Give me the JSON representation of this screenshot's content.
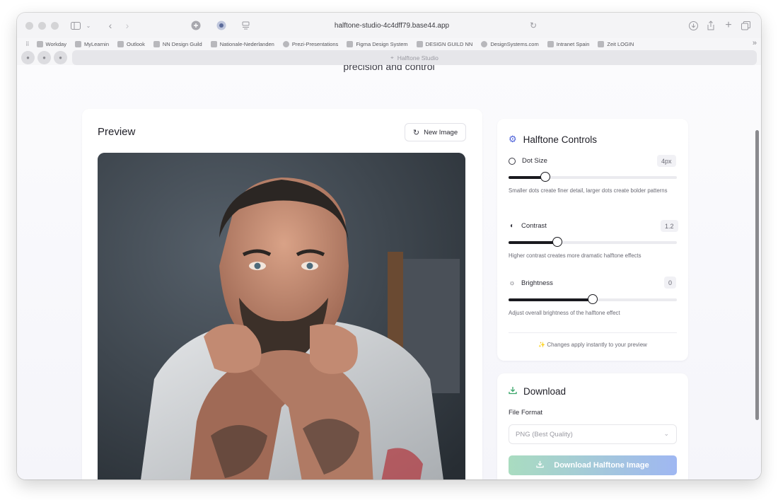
{
  "browser": {
    "url": "halftone-studio-4c4dff79.base44.app",
    "tab_title": "Halftone Studio",
    "bookmarks": [
      {
        "label": "Workday"
      },
      {
        "label": "MyLearnin"
      },
      {
        "label": "Outlook"
      },
      {
        "label": "NN Design Guild"
      },
      {
        "label": "Nationale-Nederlanden"
      },
      {
        "label": "Prezi-Presentations"
      },
      {
        "label": "Figma Design System"
      },
      {
        "label": "DESIGN GUILD NN"
      },
      {
        "label": "DesignSystems.com"
      },
      {
        "label": "Intranet Spain"
      },
      {
        "label": "Zeit LOGIN"
      }
    ]
  },
  "hero": {
    "tail_text": "precision and control"
  },
  "preview": {
    "title": "Preview",
    "new_image_label": "New Image"
  },
  "controls": {
    "title": "Halftone Controls",
    "dot_size": {
      "label": "Dot Size",
      "value_text": "4px",
      "level": 0.22,
      "hint": "Smaller dots create finer detail, larger dots create bolder patterns"
    },
    "contrast": {
      "label": "Contrast",
      "value_text": "1.2",
      "level": 0.29,
      "hint": "Higher contrast creates more dramatic halftone effects"
    },
    "brightness": {
      "label": "Brightness",
      "value_text": "0",
      "level": 0.5,
      "hint": "Adjust overall brightness of the halftone effect"
    },
    "note": "✨ Changes apply instantly to your preview"
  },
  "download": {
    "title": "Download",
    "format_label": "File Format",
    "format_value": "PNG (Best Quality)",
    "button_label": "Download Halftone Image"
  },
  "colors": {
    "accent_blue": "#4a5fd8",
    "download_green": "#3aa66a"
  }
}
